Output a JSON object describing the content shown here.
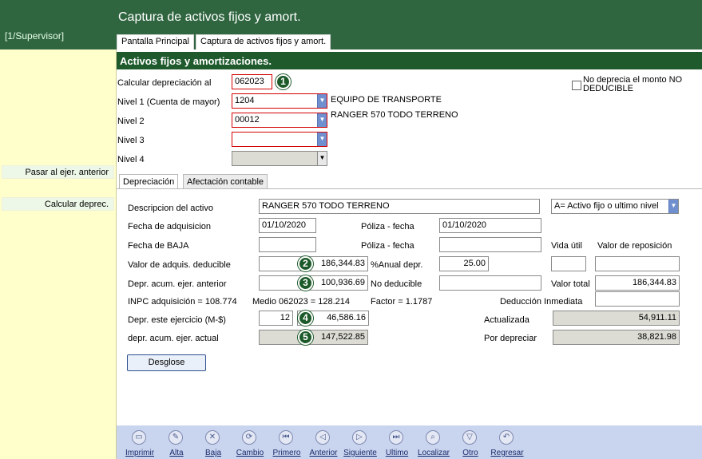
{
  "app": {
    "title": "Captura de activos fijos y amort.",
    "user": "[1/Supervisor]",
    "tabs": [
      "Pantalla Principal",
      "Captura de activos fijos y amort."
    ]
  },
  "sidebar": {
    "buttons": [
      "Pasar al ejer. anterior",
      "Calcular deprec."
    ]
  },
  "section_title": "Activos fijos y amortizaciones.",
  "header_form": {
    "calc_label": "Calcular depreciación al",
    "calc_value": "062023",
    "nivel1_label": "Nivel 1 (Cuenta de mayor)",
    "nivel1_value": "1204",
    "nivel1_desc": "EQUIPO DE TRANSPORTE",
    "nivel2_label": "Nivel 2",
    "nivel2_value": "00012",
    "nivel2_desc": "RANGER 570 TODO TERRENO",
    "nivel3_label": "Nivel 3",
    "nivel3_value": "",
    "nivel4_label": "Nivel 4",
    "nivel4_value": "",
    "no_deprecia_label": "No deprecia el monto NO DEDUCIBLE"
  },
  "inner_tabs": [
    "Depreciación",
    "Afectación contable"
  ],
  "detail": {
    "descripcion_label": "Descripcion del activo",
    "descripcion_value": "RANGER 570 TODO TERRENO",
    "tipo_value": "A= Activo fijo o ultimo nivel",
    "fecha_adq_label": "Fecha de adquisicion",
    "fecha_adq_value": "01/10/2020",
    "poliza_fecha_label": "Póliza - fecha",
    "poliza_fecha_value": "01/10/2020",
    "fecha_baja_label": "Fecha de BAJA",
    "fecha_baja_value": "",
    "poliza_fecha2_label": "Póliza - fecha",
    "poliza_fecha2_value": "",
    "vida_util_label": "Vida útil",
    "valor_reposicion_label": "Valor de reposición",
    "valor_adq_label": "Valor de adquis. deducible",
    "valor_adq_value": "186,344.83",
    "anual_depr_label": "%Anual depr.",
    "anual_depr_value": "25.00",
    "depr_acum_ant_label": "Depr. acum. ejer. anterior",
    "depr_acum_ant_value": "100,936.69",
    "no_deducible_label": "No deducible",
    "valor_total_label": "Valor total",
    "valor_total_value": "186,344.83",
    "inpc_adq": "INPC adquisición = 108.774",
    "medio": "Medio 062023 = 128.214",
    "factor": "Factor = 1.1787",
    "deduccion_label": "Deducción Inmediata",
    "depr_ejercicio_label": "Depr. este ejercicio (M-$)",
    "depr_ejercicio_meses": "12",
    "depr_ejercicio_value": "46,586.16",
    "actualizada_label": "Actualizada",
    "actualizada_value": "54,911.11",
    "depr_acum_act_label": "depr. acum. ejer. actual",
    "depr_acum_act_value": "147,522.85",
    "por_depreciar_label": "Por depreciar",
    "por_depreciar_value": "38,821.98",
    "desglose_button": "Desglose"
  },
  "badges": [
    "1",
    "2",
    "3",
    "4",
    "5"
  ],
  "toolbar": [
    {
      "label": "Imprimir",
      "icon": "printer-icon",
      "glyph": "▭"
    },
    {
      "label": "Alta",
      "icon": "add-document-icon",
      "glyph": "✎"
    },
    {
      "label": "Baja",
      "icon": "delete-document-icon",
      "glyph": "✕"
    },
    {
      "label": "Cambio",
      "icon": "change-icon",
      "glyph": "⟳"
    },
    {
      "label": "Primero",
      "icon": "first-record-icon",
      "glyph": "⏮"
    },
    {
      "label": "Anterior",
      "icon": "previous-record-icon",
      "glyph": "◁"
    },
    {
      "label": "Siguiente",
      "icon": "next-record-icon",
      "glyph": "▷"
    },
    {
      "label": "Ultimo",
      "icon": "last-record-icon",
      "glyph": "⏭"
    },
    {
      "label": "Localizar",
      "icon": "search-icon",
      "glyph": "⌕"
    },
    {
      "label": "Otro",
      "icon": "other-icon",
      "glyph": "▽"
    },
    {
      "label": "Regresar",
      "icon": "return-icon",
      "glyph": "↶"
    }
  ]
}
